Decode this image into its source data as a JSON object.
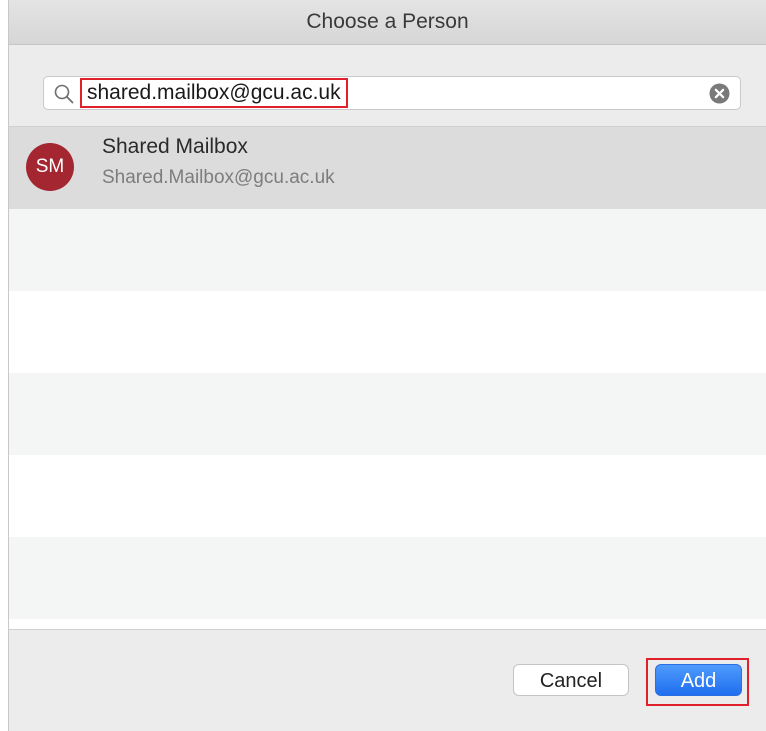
{
  "dialog": {
    "title": "Choose a Person"
  },
  "search": {
    "value": "shared.mailbox@gcu.ac.uk",
    "icon": "search-icon",
    "clear_icon": "clear-circle-icon"
  },
  "results": [
    {
      "initials": "SM",
      "name": "Shared Mailbox",
      "email": "Shared.Mailbox@gcu.ac.uk",
      "avatar_color": "#a32631",
      "selected": true
    }
  ],
  "buttons": {
    "cancel_label": "Cancel",
    "add_label": "Add"
  },
  "colors": {
    "accent": "#1f6ef0",
    "highlight": "#e0202a"
  }
}
